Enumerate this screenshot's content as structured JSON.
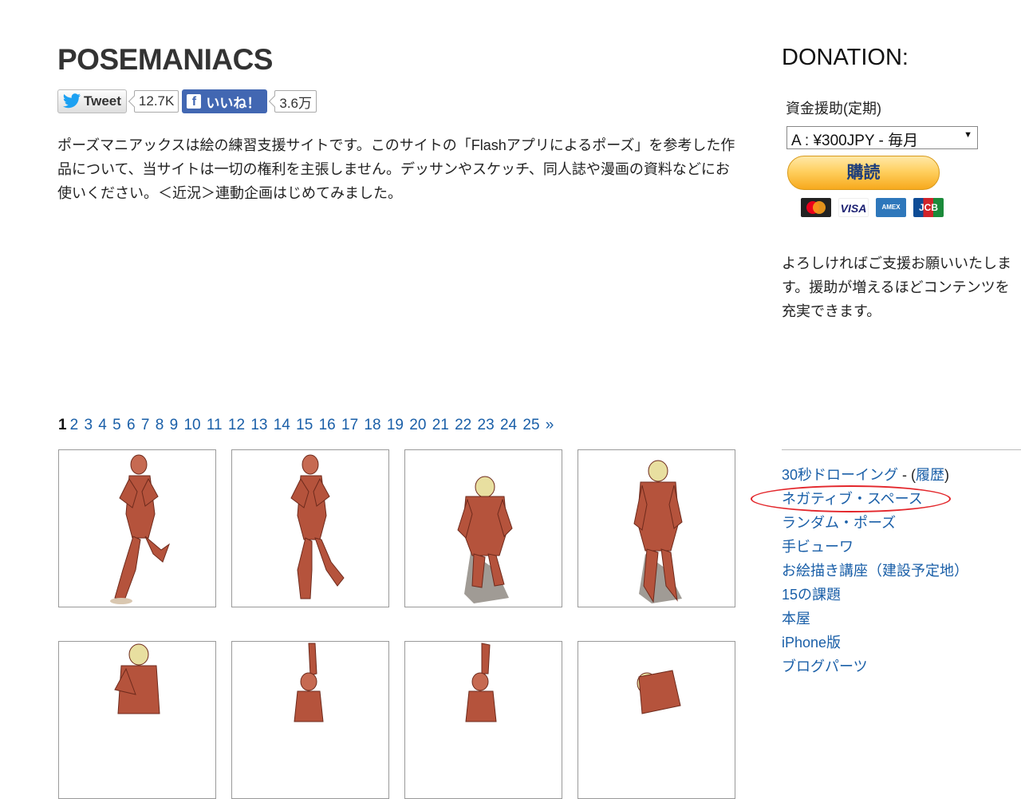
{
  "header": {
    "site_title": "POSEMANIACS"
  },
  "social": {
    "tweet_label": "Tweet",
    "tweet_count": "12.7K",
    "like_label": "いいね！",
    "like_count": "3.6万"
  },
  "intro": "ポーズマニアックスは絵の練習支援サイトです。このサイトの「Flashアプリによるポーズ」を参考した作品について、当サイトは一切の権利を主張しません。デッサンやスケッチ、同人誌や漫画の資料などにお使いください。＜近況＞連動企画はじめてみました。",
  "pagination": {
    "current": "1",
    "pages": [
      "2",
      "3",
      "4",
      "5",
      "6",
      "7",
      "8",
      "9",
      "10",
      "11",
      "12",
      "13",
      "14",
      "15",
      "16",
      "17",
      "18",
      "19",
      "20",
      "21",
      "22",
      "23",
      "24",
      "25"
    ],
    "next": "»"
  },
  "thumbnails": [
    {
      "pose": "boxing-stance-knee-raised"
    },
    {
      "pose": "boxing-stance-step"
    },
    {
      "pose": "crouch-with-shadow"
    },
    {
      "pose": "stand-with-shadow"
    },
    {
      "pose": "guard-upper-body"
    },
    {
      "pose": "arm-raised"
    },
    {
      "pose": "arm-raised-side"
    },
    {
      "pose": "bent-over"
    }
  ],
  "donation": {
    "title": "DONATION:",
    "subscribe_label": "資金援助(定期)",
    "plan_selected": "A : ¥300JPY - 毎月",
    "buy_label": "購読",
    "card_brands": [
      "MasterCard",
      "VISA",
      "AMERICAN EXPRESS",
      "JCB"
    ],
    "message": "よろしければご支援お願いいたします。援助が増えるほどコンテンツを充実できます。"
  },
  "links": {
    "drawing30": "30秒ドローイング",
    "separator": " - (",
    "history": "履歴",
    "close_paren": ")",
    "negative_space": "ネガティブ・スペース",
    "random_pose": "ランダム・ポーズ",
    "hand_viewer": "手ビューワ",
    "lessons": "お絵描き講座（建設予定地）",
    "challenges": "15の課題",
    "bookstore": "本屋",
    "iphone": "iPhone版",
    "blog_parts": "ブログパーツ"
  },
  "colors": {
    "link": "#1a5fa8",
    "highlight": "#e3262b",
    "facebook": "#4267b2",
    "paypal": "#ffc439"
  }
}
